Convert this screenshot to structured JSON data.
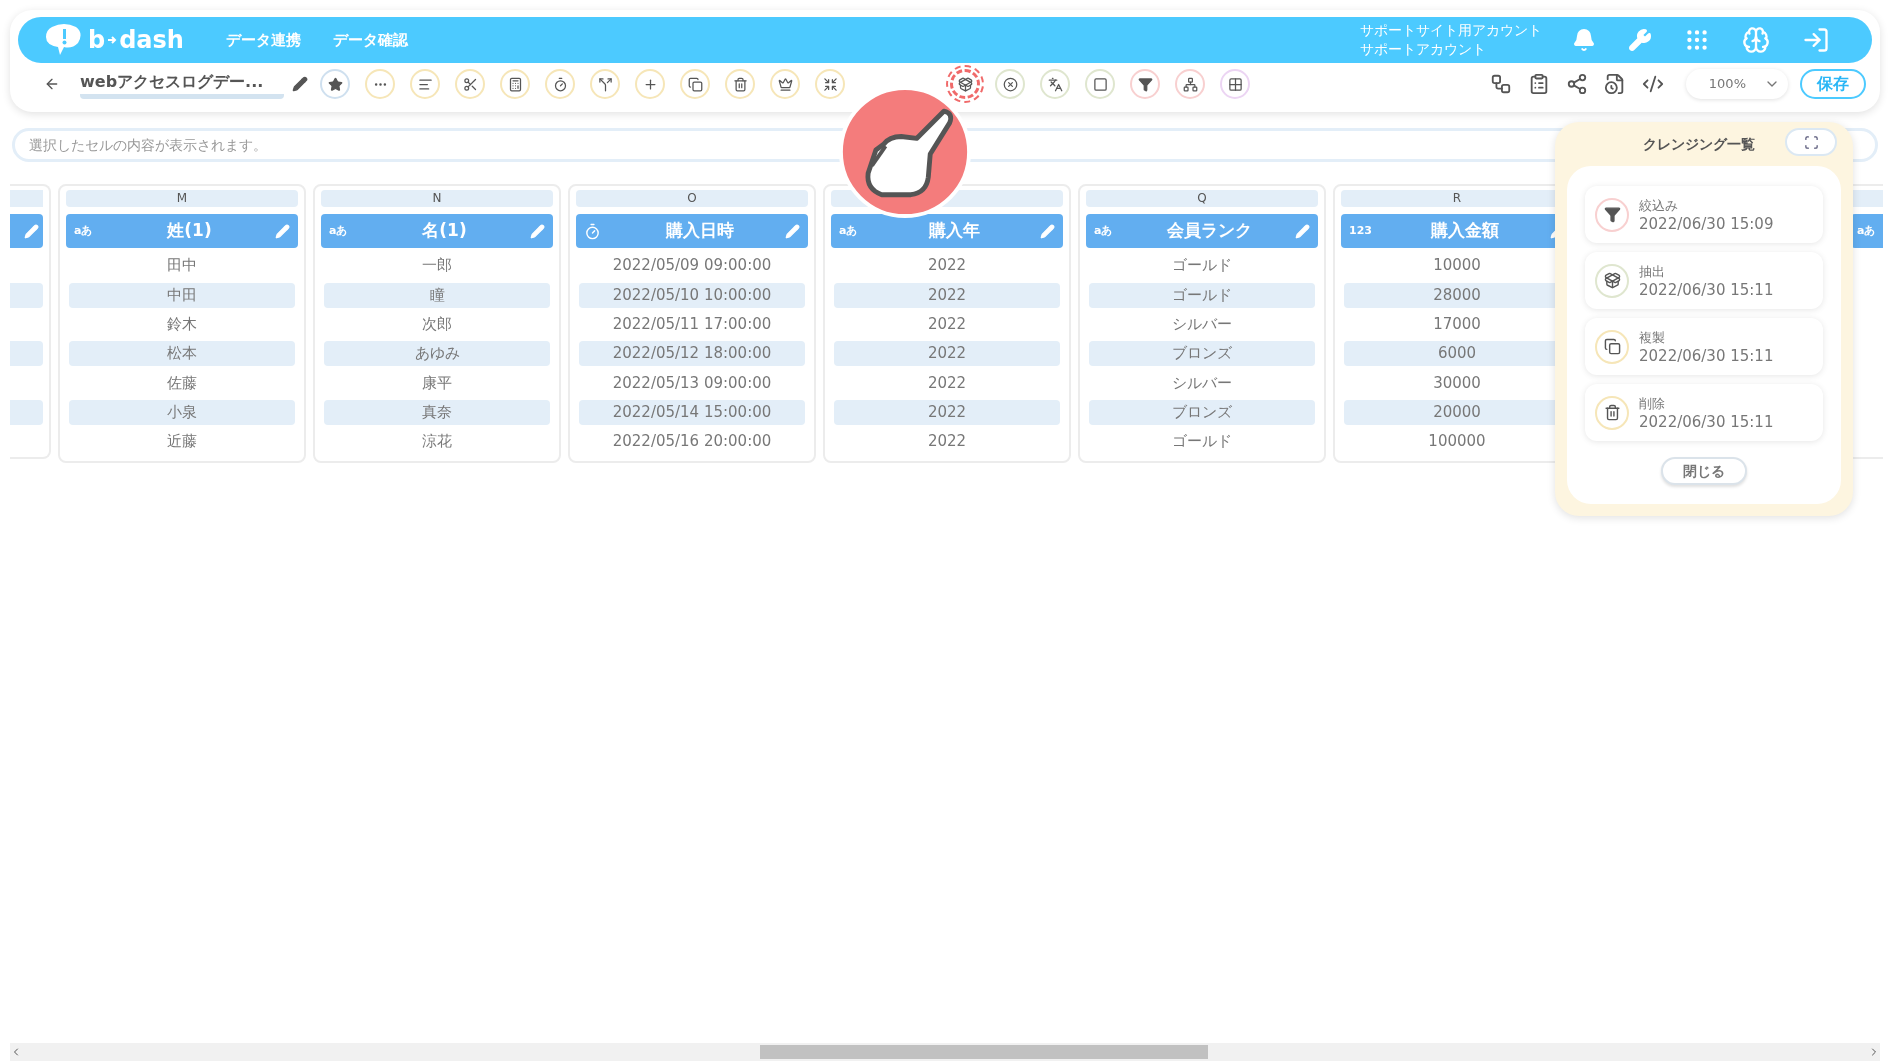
{
  "header": {
    "logo": [
      "b",
      "dash"
    ],
    "nav": [
      "データ連携",
      "データ確認"
    ],
    "account": [
      "サポートサイト用アカウント",
      "サポートアカウント"
    ]
  },
  "toolbar": {
    "title": "webアクセスログデー...",
    "tools": [
      {
        "selected": false
      },
      {
        "selected": false
      },
      {
        "selected": false
      },
      {
        "selected": false
      },
      {
        "selected": false
      },
      {
        "selected": false
      },
      {
        "selected": false
      },
      {
        "selected": false
      },
      {
        "selected": false
      },
      {
        "selected": false
      },
      {
        "selected": false
      },
      {
        "selected": false
      },
      {
        "selected": true
      },
      {
        "selected": false
      },
      {
        "selected": false
      },
      {
        "selected": false
      },
      {
        "selected": false
      },
      {
        "selected": false
      },
      {
        "selected": false
      }
    ],
    "zoom": "100%",
    "save": "保存"
  },
  "selection_field": {
    "placeholder": "選択したセルの内容が表示されます。"
  },
  "columns": [
    {
      "letter": "M",
      "kind": "text",
      "type_label": "aあ",
      "title": "姓(1)",
      "cells": [
        "田中",
        "中田",
        "鈴木",
        "松本",
        "佐藤",
        "小泉",
        "近藤"
      ]
    },
    {
      "letter": "N",
      "kind": "text",
      "type_label": "aあ",
      "title": "名(1)",
      "cells": [
        "一郎",
        "瞳",
        "次郎",
        "あゆみ",
        "康平",
        "真奈",
        "涼花"
      ]
    },
    {
      "letter": "O",
      "kind": "datetime",
      "title": "購入日時",
      "cells": [
        "2022/05/09 09:00:00",
        "2022/05/10 10:00:00",
        "2022/05/11 17:00:00",
        "2022/05/12 18:00:00",
        "2022/05/13 09:00:00",
        "2022/05/14 15:00:00",
        "2022/05/16 20:00:00"
      ]
    },
    {
      "kind": "text",
      "type_label": "aあ",
      "title": "購入年",
      "cells": [
        "2022",
        "2022",
        "2022",
        "2022",
        "2022",
        "2022",
        "2022"
      ]
    },
    {
      "letter": "Q",
      "kind": "text",
      "type_label": "aあ",
      "title": "会員ランク",
      "cells": [
        "ゴールド",
        "ゴールド",
        "シルバー",
        "ブロンズ",
        "シルバー",
        "ブロンズ",
        "ゴールド"
      ]
    },
    {
      "letter": "R",
      "kind": "number",
      "type_label": "123",
      "title": "購入金額",
      "cells": [
        "10000",
        "28000",
        "17000",
        "6000",
        "30000",
        "20000",
        "100000"
      ]
    }
  ],
  "edge_column_type_label": "aあ",
  "panel": {
    "title": "クレンジング一覧",
    "items": [
      {
        "kind": "filter",
        "name": "絞込み",
        "time": "2022/06/30 15:09"
      },
      {
        "kind": "extract",
        "name": "抽出",
        "time": "2022/06/30 15:11"
      },
      {
        "kind": "copy",
        "name": "複製",
        "time": "2022/06/30 15:11"
      },
      {
        "kind": "delete",
        "name": "削除",
        "time": "2022/06/30 15:11"
      }
    ],
    "close": "閉じる"
  }
}
